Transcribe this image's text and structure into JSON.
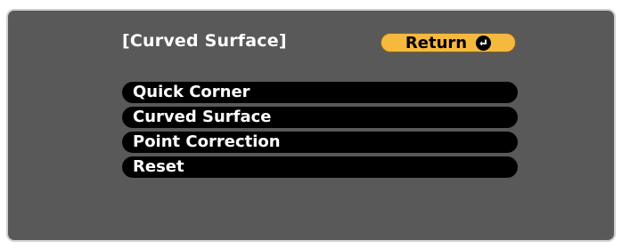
{
  "screen": {
    "title": "[Curved Surface]",
    "return_button": {
      "label": "Return",
      "icon": "enter-return-icon"
    },
    "menu": {
      "items": [
        {
          "label": "Quick Corner"
        },
        {
          "label": "Curved Surface"
        },
        {
          "label": "Point Correction"
        },
        {
          "label": "Reset"
        }
      ]
    }
  },
  "colors": {
    "panel_background": "#595959",
    "return_button": "#f4b93e",
    "menu_item_background": "#000000",
    "text": "#ffffff"
  }
}
